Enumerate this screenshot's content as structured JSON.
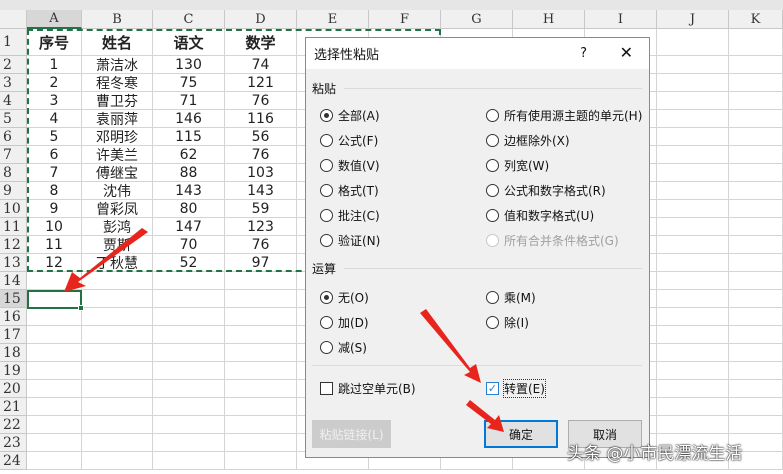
{
  "columns": [
    "A",
    "B",
    "C",
    "D",
    "E",
    "F",
    "G",
    "H",
    "I",
    "J",
    "K"
  ],
  "row_numbers": [
    "1",
    "2",
    "3",
    "4",
    "5",
    "6",
    "7",
    "8",
    "9",
    "10",
    "11",
    "12",
    "13",
    "14",
    "15",
    "16",
    "17",
    "18",
    "19",
    "20",
    "21",
    "22",
    "23",
    "24"
  ],
  "table": {
    "headers": [
      "序号",
      "姓名",
      "语文",
      "数学"
    ],
    "rows": [
      [
        "1",
        "萧洁冰",
        "130",
        "74"
      ],
      [
        "2",
        "程冬寒",
        "75",
        "121"
      ],
      [
        "3",
        "曹卫芬",
        "71",
        "76"
      ],
      [
        "4",
        "袁丽萍",
        "146",
        "116"
      ],
      [
        "5",
        "邓明珍",
        "115",
        "56"
      ],
      [
        "6",
        "许美兰",
        "62",
        "76"
      ],
      [
        "7",
        "傅继宝",
        "88",
        "103"
      ],
      [
        "8",
        "沈伟",
        "143",
        "143"
      ],
      [
        "9",
        "曾彩凤",
        "80",
        "59"
      ],
      [
        "10",
        "彭鸿",
        "147",
        "123"
      ],
      [
        "11",
        "贾斯",
        "70",
        "76"
      ],
      [
        "12",
        "丁秋慧",
        "52",
        "97"
      ]
    ]
  },
  "dialog": {
    "title": "选择性粘贴",
    "help": "?",
    "close": "✕",
    "paste_label": "粘贴",
    "paste_left": [
      {
        "label": "全部(A)",
        "checked": true
      },
      {
        "label": "公式(F)"
      },
      {
        "label": "数值(V)"
      },
      {
        "label": "格式(T)"
      },
      {
        "label": "批注(C)"
      },
      {
        "label": "验证(N)"
      }
    ],
    "paste_right": [
      {
        "label": "所有使用源主题的单元(H)"
      },
      {
        "label": "边框除外(X)"
      },
      {
        "label": "列宽(W)"
      },
      {
        "label": "公式和数字格式(R)"
      },
      {
        "label": "值和数字格式(U)"
      },
      {
        "label": "所有合并条件格式(G)",
        "disabled": true
      }
    ],
    "op_label": "运算",
    "op_left": [
      {
        "label": "无(O)",
        "checked": true
      },
      {
        "label": "加(D)"
      },
      {
        "label": "减(S)"
      }
    ],
    "op_right": [
      {
        "label": "乘(M)"
      },
      {
        "label": "除(I)"
      }
    ],
    "skip_blanks": "跳过空单元(B)",
    "transpose": "转置(E)",
    "paste_link": "粘贴链接(L)",
    "ok": "确定",
    "cancel": "取消"
  },
  "watermark": "头条 @小市民漂流生活",
  "colors": {
    "accent": "#217346",
    "arrow": "#e8251c",
    "focus": "#0078d7"
  }
}
